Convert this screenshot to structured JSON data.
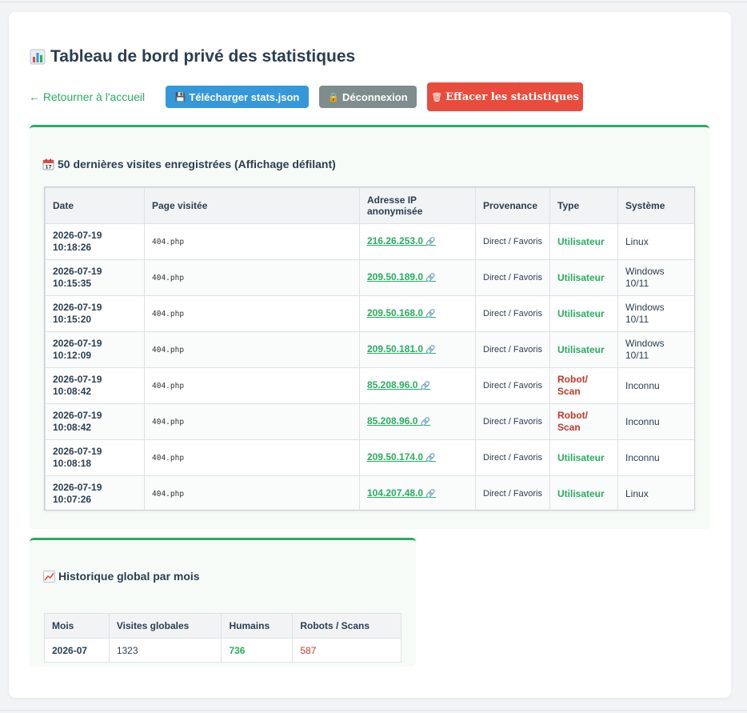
{
  "title": "Tableau de bord privé des statistiques",
  "toolbar": {
    "back_label": "← Retourner à l'accueil",
    "download_label": "Télécharger stats.json",
    "download_icon": "floppy-disk",
    "logout_label": "Déconnexion",
    "logout_icon": "lock",
    "clear_label": "Effacer les statistiques",
    "clear_icon": "wastebasket",
    "colors": {
      "download": "#3498db",
      "logout": "#7f8c8d",
      "clear": "#e74c3c",
      "back": "#27ae60"
    }
  },
  "visits": {
    "heading": "50 dernières visites enregistrées (Affichage défilant)",
    "heading_icon": "calendar",
    "columns": {
      "date": "Date",
      "page": "Page visitée",
      "ip": "Adresse IP anonymisée",
      "source": "Provenance",
      "type": "Type",
      "system": "Système"
    },
    "rows": [
      {
        "date": "2026-07-19 10:18:26",
        "page": "404.php",
        "ip": "216.26.253.0",
        "source": "Direct / Favoris",
        "type": "Utilisateur",
        "kind": "human",
        "system": "Linux"
      },
      {
        "date": "2026-07-19 10:15:35",
        "page": "404.php",
        "ip": "209.50.189.0",
        "source": "Direct / Favoris",
        "type": "Utilisateur",
        "kind": "human",
        "system": "Windows 10/11"
      },
      {
        "date": "2026-07-19 10:15:20",
        "page": "404.php",
        "ip": "209.50.168.0",
        "source": "Direct / Favoris",
        "type": "Utilisateur",
        "kind": "human",
        "system": "Windows 10/11"
      },
      {
        "date": "2026-07-19 10:12:09",
        "page": "404.php",
        "ip": "209.50.181.0",
        "source": "Direct / Favoris",
        "type": "Utilisateur",
        "kind": "human",
        "system": "Windows 10/11"
      },
      {
        "date": "2026-07-19 10:08:42",
        "page": "404.php",
        "ip": "85.208.96.0",
        "source": "Direct / Favoris",
        "type": "Robot/ Scan",
        "kind": "robot",
        "system": "Inconnu"
      },
      {
        "date": "2026-07-19 10:08:42",
        "page": "404.php",
        "ip": "85.208.96.0",
        "source": "Direct / Favoris",
        "type": "Robot/ Scan",
        "kind": "robot",
        "system": "Inconnu"
      },
      {
        "date": "2026-07-19 10:08:18",
        "page": "404.php",
        "ip": "209.50.174.0",
        "source": "Direct / Favoris",
        "type": "Utilisateur",
        "kind": "human",
        "system": "Inconnu"
      },
      {
        "date": "2026-07-19 10:07:26",
        "page": "404.php",
        "ip": "104.207.48.0",
        "source": "Direct / Favoris",
        "type": "Utilisateur",
        "kind": "human",
        "system": "Linux"
      }
    ]
  },
  "history": {
    "heading": "Historique global par mois",
    "heading_icon": "chart-increasing",
    "columns": {
      "month": "Mois",
      "visits": "Visites globales",
      "humans": "Humains",
      "robots": "Robots / Scans"
    },
    "rows": [
      {
        "month": "2026-07",
        "visits": "1323",
        "humans": "736",
        "robots": "587"
      }
    ]
  }
}
